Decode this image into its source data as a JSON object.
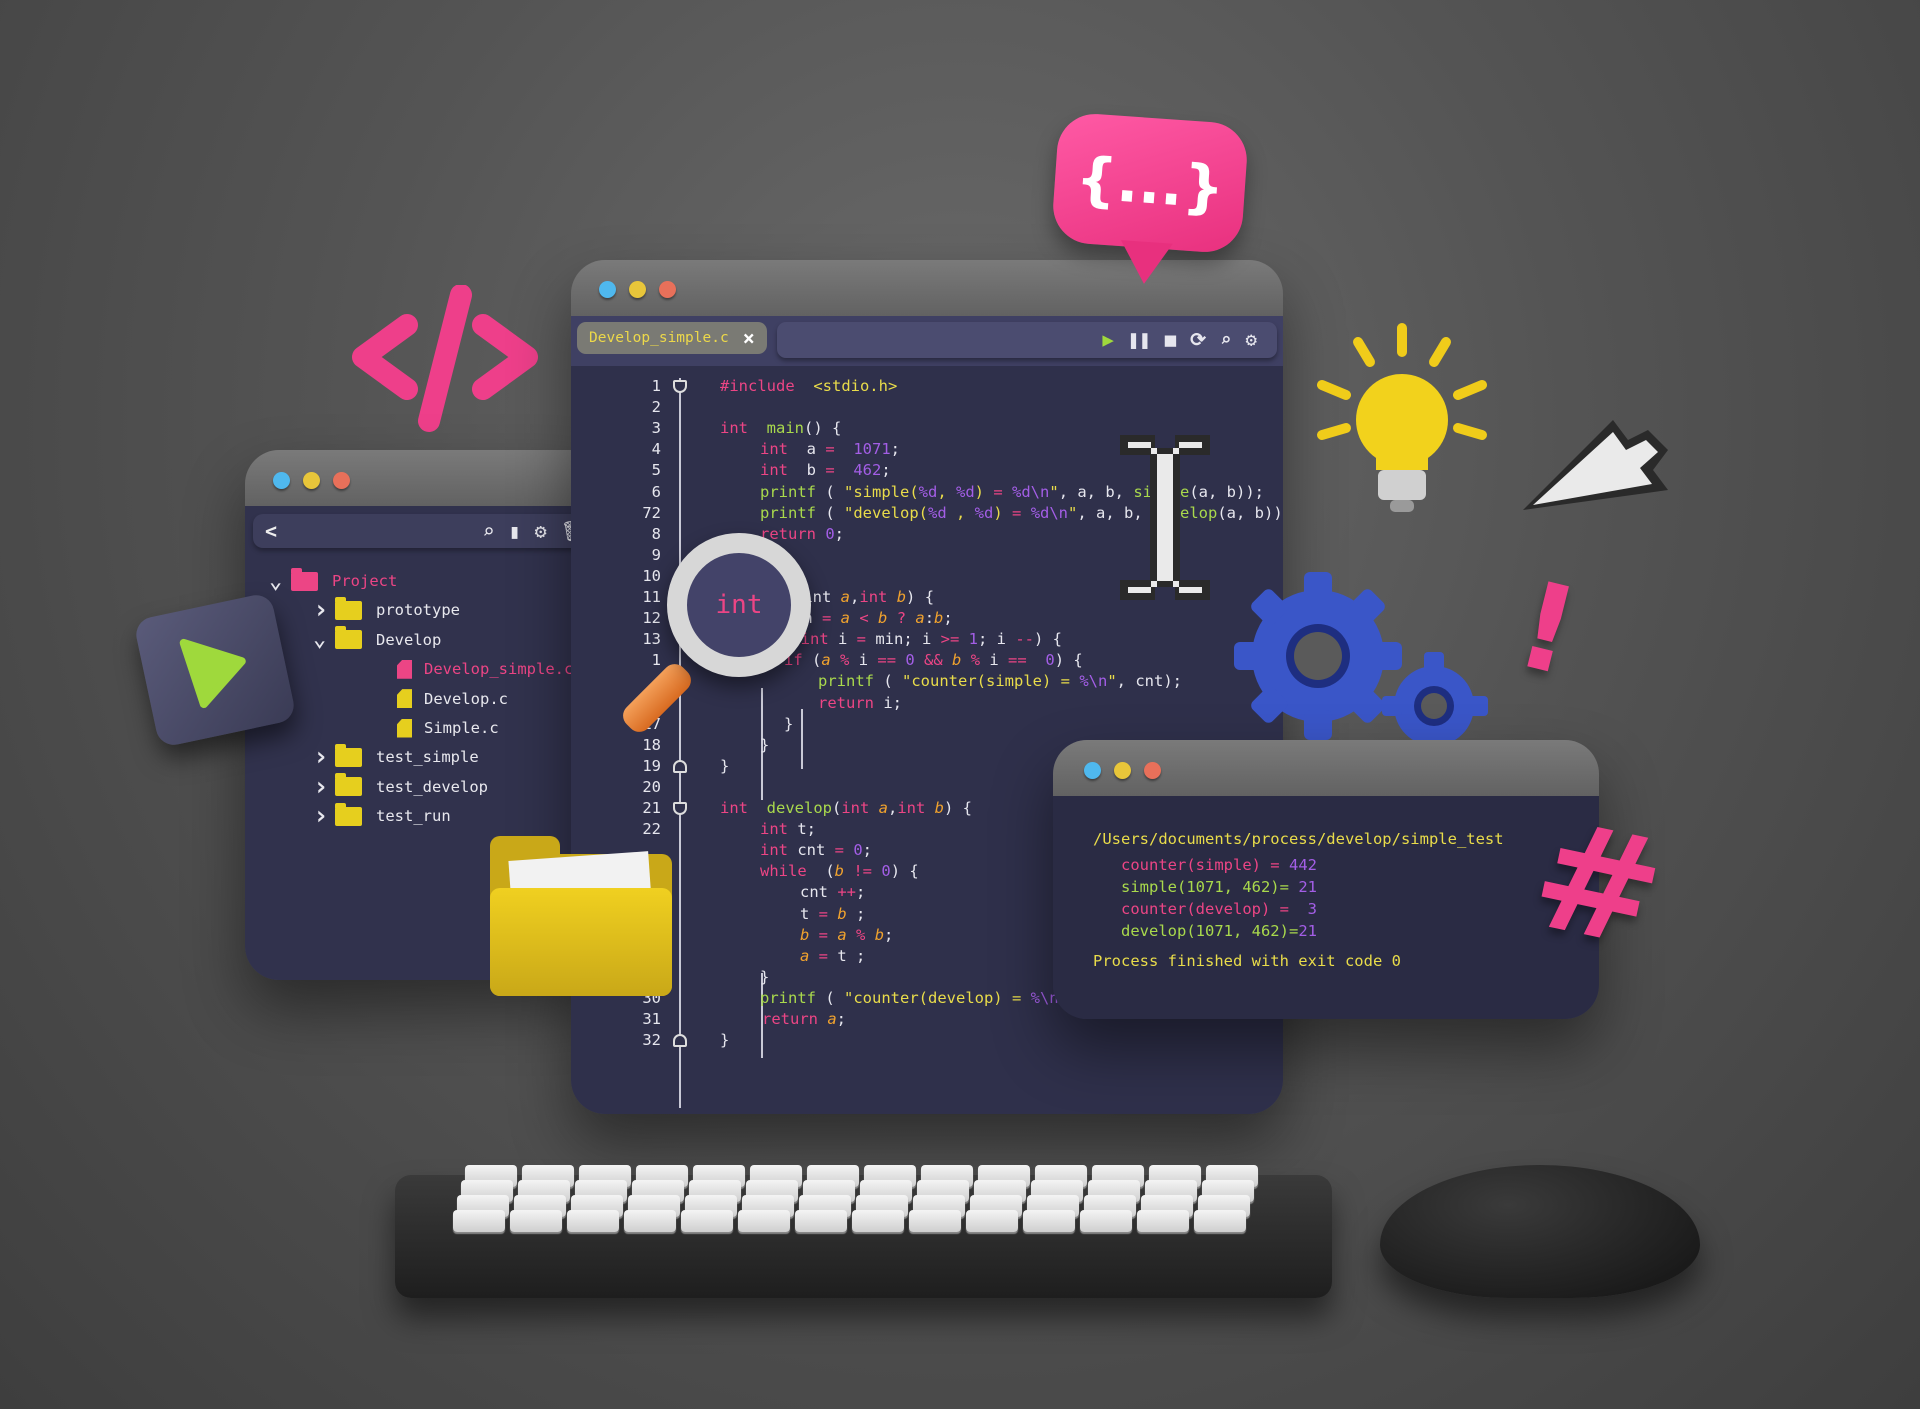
{
  "editor": {
    "tab": {
      "label": "Develop_simple.c",
      "close": "×"
    },
    "toolbar": [
      {
        "name": "play",
        "glyph": "▶"
      },
      {
        "name": "pause",
        "glyph": "❚❚"
      },
      {
        "name": "stop",
        "glyph": "■"
      },
      {
        "name": "refresh",
        "glyph": "⟳"
      },
      {
        "name": "search",
        "glyph": "⌕"
      },
      {
        "name": "settings",
        "glyph": "⚙"
      }
    ],
    "lines": [
      {
        "n": "1",
        "t": [
          [
            "k",
            "#include"
          ],
          [
            "s",
            "  <stdio.h>"
          ]
        ]
      },
      {
        "n": "2",
        "t": []
      },
      {
        "n": "3",
        "t": [
          [
            "k",
            "int "
          ],
          [
            "f",
            " main"
          ],
          [
            "w",
            "() {"
          ]
        ]
      },
      {
        "n": "4",
        "t": [
          [
            "k",
            "int "
          ],
          [
            "w",
            " a "
          ],
          [
            "o",
            "= "
          ],
          [
            "n",
            " 1071"
          ],
          [
            "w",
            ";"
          ]
        ]
      },
      {
        "n": "5",
        "t": [
          [
            "k",
            "int "
          ],
          [
            "w",
            " b "
          ],
          [
            "o",
            "= "
          ],
          [
            "n",
            " 462"
          ],
          [
            "w",
            ";"
          ]
        ]
      },
      {
        "n": "6",
        "t": [
          [
            "f",
            "printf"
          ],
          [
            "w",
            " ( "
          ],
          [
            "s",
            "\"simple("
          ],
          [
            "n",
            "%d"
          ],
          [
            "s",
            ", "
          ],
          [
            "n",
            "%d"
          ],
          [
            "s",
            ") "
          ],
          [
            "o",
            "= "
          ],
          [
            "n",
            "%d\\n"
          ],
          [
            "s",
            "\""
          ],
          [
            "w",
            ", a, b, "
          ],
          [
            "f",
            "simple"
          ],
          [
            "w",
            "(a, b));"
          ]
        ]
      },
      {
        "n": "72",
        "t": [
          [
            "f",
            "printf"
          ],
          [
            "w",
            " ( "
          ],
          [
            "s",
            "\"develop("
          ],
          [
            "n",
            "%d"
          ],
          [
            "s",
            " , "
          ],
          [
            "n",
            "%d"
          ],
          [
            "s",
            ") "
          ],
          [
            "o",
            "= "
          ],
          [
            "n",
            "%d\\n"
          ],
          [
            "s",
            "\""
          ],
          [
            "w",
            ", a, b, "
          ],
          [
            "f",
            "develop"
          ],
          [
            "w",
            "(a, b));"
          ]
        ]
      },
      {
        "n": "8",
        "t": [
          [
            "k",
            "return "
          ],
          [
            "n",
            "0"
          ],
          [
            "w",
            ";"
          ]
        ]
      },
      {
        "n": "9",
        "t": []
      },
      {
        "n": "10",
        "t": []
      },
      {
        "n": "11",
        "t": [
          [
            "w",
            "(int "
          ],
          [
            "v",
            "a"
          ],
          [
            "w",
            ","
          ],
          [
            "k",
            "int "
          ],
          [
            "v",
            "b"
          ],
          [
            "w",
            ") {"
          ]
        ]
      },
      {
        "n": "12",
        "t": [
          [
            "w",
            "in "
          ],
          [
            "o",
            "= "
          ],
          [
            "v",
            "a "
          ],
          [
            "o",
            "< "
          ],
          [
            "v",
            "b "
          ],
          [
            "o",
            "? "
          ],
          [
            "v",
            "a"
          ],
          [
            "w",
            ":"
          ],
          [
            "v",
            "b"
          ],
          [
            "w",
            ";"
          ]
        ]
      },
      {
        "n": "13",
        "t": [
          [
            "w",
            "( "
          ],
          [
            "k",
            "int "
          ],
          [
            "w",
            "i "
          ],
          [
            "o",
            "= "
          ],
          [
            "w",
            "min; i "
          ],
          [
            "o",
            ">= "
          ],
          [
            "n",
            "1"
          ],
          [
            "w",
            "; i "
          ],
          [
            "o",
            "--"
          ],
          [
            "w",
            ") {"
          ]
        ]
      },
      {
        "n": "1",
        "t": [
          [
            "k",
            "if "
          ],
          [
            "w",
            "("
          ],
          [
            "v",
            "a "
          ],
          [
            "o",
            "% "
          ],
          [
            "w",
            "i "
          ],
          [
            "o",
            "== "
          ],
          [
            "n",
            "0 "
          ],
          [
            "o",
            "&& "
          ],
          [
            "v",
            "b "
          ],
          [
            "o",
            "% "
          ],
          [
            "w",
            "i "
          ],
          [
            "o",
            "==  "
          ],
          [
            "n",
            "0"
          ],
          [
            "w",
            ") {"
          ]
        ]
      },
      {
        "n": "",
        "t": [
          [
            "f",
            "printf"
          ],
          [
            "w",
            " ( "
          ],
          [
            "s",
            "\"counter(simple) = "
          ],
          [
            "n",
            "%\\n"
          ],
          [
            "s",
            "\""
          ],
          [
            "w",
            ", cnt);"
          ]
        ]
      },
      {
        "n": "",
        "t": [
          [
            "k",
            "return "
          ],
          [
            "w",
            "i;"
          ]
        ]
      },
      {
        "n": "17",
        "t": [
          [
            "w",
            "}"
          ]
        ]
      },
      {
        "n": "18",
        "t": [
          [
            "w",
            "}"
          ]
        ]
      },
      {
        "n": "19",
        "t": [
          [
            "w",
            "}"
          ]
        ]
      },
      {
        "n": "20",
        "t": []
      },
      {
        "n": "21",
        "t": [
          [
            "k",
            "int "
          ],
          [
            "f",
            " develop"
          ],
          [
            "w",
            "("
          ],
          [
            "k",
            "int "
          ],
          [
            "v",
            "a"
          ],
          [
            "w",
            ","
          ],
          [
            "k",
            "int "
          ],
          [
            "v",
            "b"
          ],
          [
            "w",
            ") {"
          ]
        ]
      },
      {
        "n": "22",
        "t": [
          [
            "k",
            "int "
          ],
          [
            "w",
            "t;"
          ]
        ]
      },
      {
        "n": "",
        "t": [
          [
            "k",
            "int "
          ],
          [
            "w",
            "cnt "
          ],
          [
            "o",
            "= "
          ],
          [
            "n",
            "0"
          ],
          [
            "w",
            ";"
          ]
        ]
      },
      {
        "n": "",
        "t": [
          [
            "k",
            "while "
          ],
          [
            "w",
            " ("
          ],
          [
            "v",
            "b "
          ],
          [
            "o",
            "!= "
          ],
          [
            "n",
            "0"
          ],
          [
            "w",
            ") {"
          ]
        ]
      },
      {
        "n": "",
        "t": [
          [
            "w",
            "cnt "
          ],
          [
            "o",
            "++"
          ],
          [
            "w",
            ";"
          ]
        ]
      },
      {
        "n": "",
        "t": [
          [
            "w",
            "t "
          ],
          [
            "o",
            "= "
          ],
          [
            "v",
            "b"
          ],
          [
            "w",
            " ;"
          ]
        ]
      },
      {
        "n": "",
        "t": [
          [
            "v",
            "b "
          ],
          [
            "o",
            "= "
          ],
          [
            "v",
            "a "
          ],
          [
            "o",
            "% "
          ],
          [
            "v",
            "b"
          ],
          [
            "w",
            ";"
          ]
        ]
      },
      {
        "n": "",
        "t": [
          [
            "v",
            "a "
          ],
          [
            "o",
            "= "
          ],
          [
            "w",
            "t ;"
          ]
        ]
      },
      {
        "n": "",
        "t": [
          [
            "w",
            "}"
          ]
        ]
      },
      {
        "n": "30",
        "t": [
          [
            "f",
            "printf"
          ],
          [
            "w",
            " ( "
          ],
          [
            "s",
            "\"counter(develop) = "
          ],
          [
            "n",
            "%\\n"
          ],
          [
            "s",
            " \""
          ],
          [
            "w",
            ", cnt);"
          ]
        ]
      },
      {
        "n": "31",
        "t": [
          [
            "k",
            "return "
          ],
          [
            "v",
            "a"
          ],
          [
            "w",
            ";"
          ]
        ]
      },
      {
        "n": "32",
        "t": [
          [
            "w",
            "}"
          ]
        ]
      }
    ]
  },
  "explorer": {
    "back": "<",
    "toolbar": [
      "search",
      "new-file",
      "settings",
      "delete"
    ],
    "tree": [
      {
        "label": "Project",
        "kind": "folder",
        "color": "#ec4585",
        "expanded": true
      },
      {
        "label": "prototype",
        "kind": "folder",
        "color": "#e6cf1e",
        "expanded": false
      },
      {
        "label": "Develop",
        "kind": "folder",
        "color": "#e6cf1e",
        "expanded": true
      },
      {
        "label": "Develop_simple.c",
        "kind": "file",
        "color": "#ec4585",
        "selected": true
      },
      {
        "label": "Develop.c",
        "kind": "file",
        "color": "#e6cf1e"
      },
      {
        "label": "Simple.c",
        "kind": "file",
        "color": "#e6cf1e"
      },
      {
        "label": "test_simple",
        "kind": "folder",
        "color": "#e6cf1e",
        "expanded": false
      },
      {
        "label": "test_develop",
        "kind": "folder",
        "color": "#e6cf1e",
        "expanded": false
      },
      {
        "label": "test_run",
        "kind": "folder",
        "color": "#e6cf1e",
        "expanded": false
      }
    ]
  },
  "terminal": {
    "path": "/Users/documents/process/develop/simple_test",
    "output": [
      {
        "label": "counter(simple) = ",
        "value": "442",
        "kind": "counter"
      },
      {
        "label": "simple(1071, 462)= ",
        "value": "21",
        "kind": "result"
      },
      {
        "label": "counter(develop) =  ",
        "value": "3",
        "kind": "counter"
      },
      {
        "label": "develop(1071, 462)=",
        "value": "21",
        "kind": "result"
      }
    ],
    "finished": "Process finished with exit code 0"
  },
  "decor": {
    "code_tag": "</>",
    "bubble": "{...}",
    "magnifier": "int",
    "exclamation": "!",
    "hash": "#"
  },
  "colors": {
    "keyword": "#ec4585",
    "function": "#a9d94c",
    "string": "#e9dc4a",
    "number": "#a35ee6",
    "variable": "#f0a22e",
    "editor_bg": "#2f304b"
  }
}
